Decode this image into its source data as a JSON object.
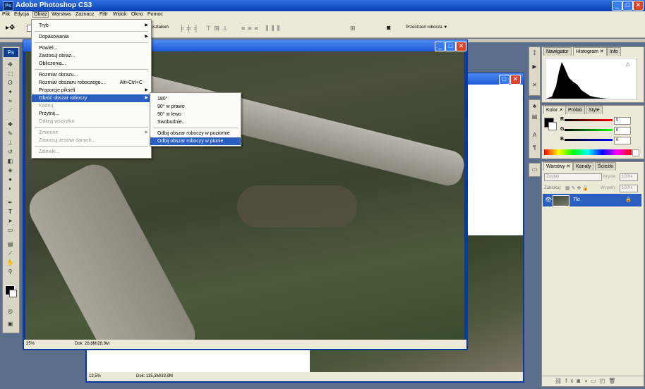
{
  "app": {
    "title": "Adobe Photoshop CS3",
    "logo": "Ps"
  },
  "menubar": [
    "Plik",
    "Edycja",
    "Obraz",
    "Warstwa",
    "Zaznacz",
    "Filtr",
    "Widok",
    "Okno",
    "Pomoc"
  ],
  "options": {
    "partial_label": "kształceń",
    "workspace_label": "Przestrzeń robocza"
  },
  "doc1": {
    "zoom": "25%",
    "info": "Dok: 28,8M/28,8M"
  },
  "doc2": {
    "zoom": "12,5%",
    "info": "Dok: 115,3M/33,9M"
  },
  "image_menu": {
    "items": [
      {
        "label": "Tryb",
        "submenu": true
      },
      {
        "label": "Dopasowania",
        "submenu": true
      },
      {
        "label": "Powiel..."
      },
      {
        "label": "Zastosuj obraz..."
      },
      {
        "label": "Obliczenia..."
      },
      {
        "label": "Rozmiar obrazu..."
      },
      {
        "label": "Rozmiar obszaru roboczego...",
        "shortcut": "Alt+Ctrl+C"
      },
      {
        "label": "Proporcje pikseli",
        "submenu": true
      },
      {
        "label": "Obróć obszar roboczy",
        "submenu": true,
        "highlighted": true
      },
      {
        "label": "Kadruj",
        "disabled": true
      },
      {
        "label": "Przytnij..."
      },
      {
        "label": "Odkryj wszystko",
        "disabled": true
      },
      {
        "label": "Zmienne",
        "submenu": true,
        "disabled": true
      },
      {
        "label": "Zastosuj zestaw danych...",
        "disabled": true
      },
      {
        "label": "Zalewki...",
        "disabled": true
      }
    ]
  },
  "rotate_submenu": {
    "items": [
      {
        "label": "180°"
      },
      {
        "label": "90° w prawo"
      },
      {
        "label": "90° w lewo"
      },
      {
        "label": "Swobodnie..."
      },
      {
        "label": "Odbij obszar roboczy w poziomie"
      },
      {
        "label": "Odbij obszar roboczy w pionie",
        "highlighted": true
      }
    ]
  },
  "panels": {
    "top_tabs": [
      "Nawigator",
      "Histogram",
      "Info"
    ],
    "color_tabs": [
      "Kolor",
      "Próbki",
      "Style"
    ],
    "color": {
      "r_label": "R",
      "g_label": "G",
      "b_label": "B",
      "r": "0",
      "g": "0",
      "b": "0"
    },
    "layers_tabs": [
      "Warstwy",
      "Kanały",
      "Ścieżki"
    ],
    "layers": {
      "blend_mode": "Zwykły",
      "opacity_label": "Krycie:",
      "opacity": "100%",
      "lock_label": "Zablokuj:",
      "fill_label": "Wypełń:",
      "fill": "100%",
      "layer_name": "Tło"
    }
  },
  "colors": {
    "accent": "#2a5fc0",
    "titlebar": "#0a3fb0"
  }
}
